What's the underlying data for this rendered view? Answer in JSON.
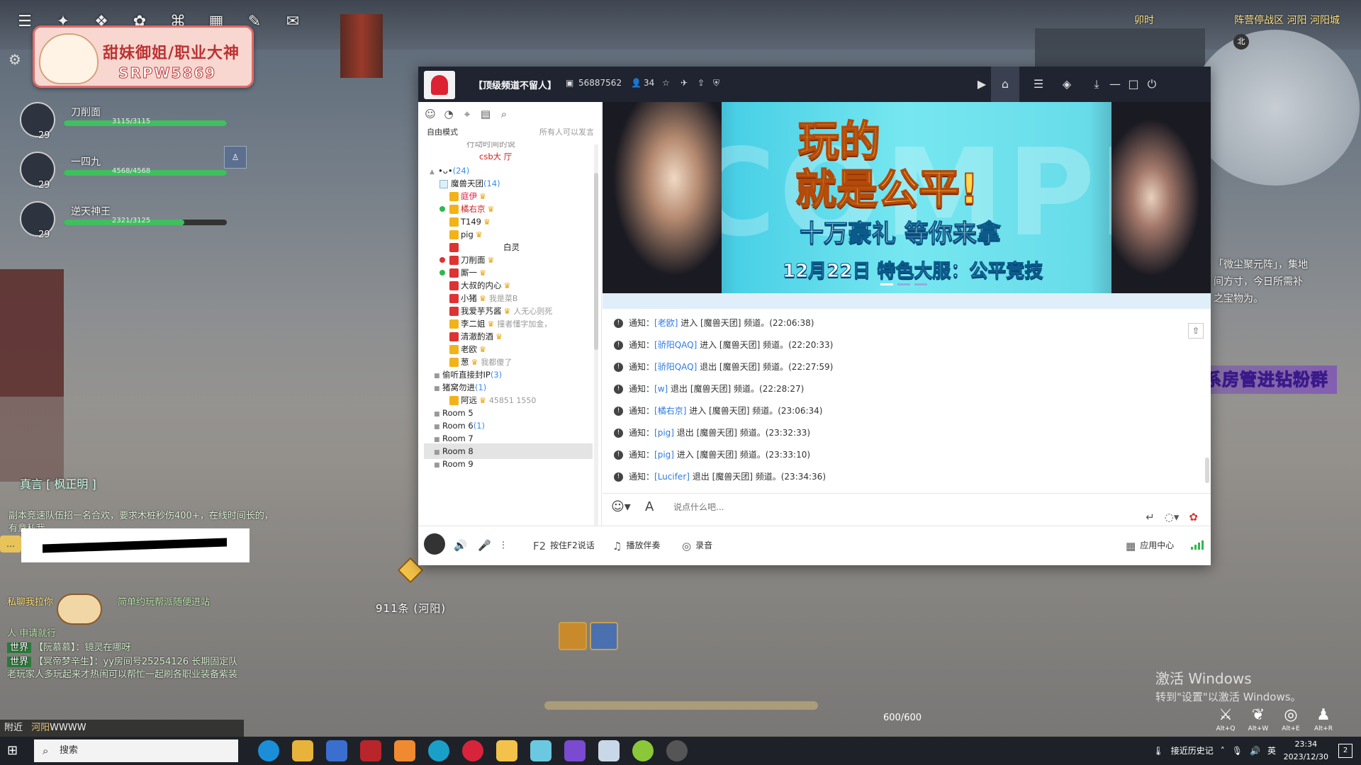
{
  "game": {
    "time": "卯时",
    "zone": "阵营停战区  河阳  河阳城",
    "sign": {
      "line1": "甜妹御姐/职业大神",
      "line2": "SRPW5869"
    },
    "party": [
      {
        "name": "刀削面",
        "hp": "3115/3115",
        "level": "29",
        "hp_fraction": 1.0
      },
      {
        "name": "一四九",
        "hp": "4568/4568",
        "level": "29",
        "hp_fraction": 1.0
      },
      {
        "name": "逆天神王",
        "hp": "2321/3125",
        "level": "29",
        "hp_fraction": 0.74
      }
    ],
    "speaker": "真言 [ 枫正明 ]",
    "chat": [
      "副本竞速队伍招一名合欢，要求木桩秒伤400+，在线时间长的，有意私我",
      "私聊我拉你",
      "简单约玩帮派随便进站",
      "人 申请就行"
    ],
    "world_chat": [
      {
        "tag": "世界",
        "text": "【阮慕慕】：镜灵在哪呀"
      },
      {
        "tag": "世界",
        "text": "【冥帝梦辛生】：yy房间号25254126 长期固定队老玩家人多玩起来才热闹可以帮忙一起刷各职业装备紫装"
      }
    ],
    "nearby": {
      "label": "附近",
      "location": "河阳",
      "text": "WWWW"
    },
    "npc_label": "911条 (河阳)",
    "side_text": [
      "「微尘聚元阵」，集地",
      "间方寸，今日所需补",
      "之宝物为。"
    ],
    "promo_banner": "钻粉开通联系房管进钻粉群",
    "energy": "600/600",
    "activate_windows": {
      "title": "激活 Windows",
      "sub": "转到\"设置\"以激活 Windows。"
    },
    "skills": [
      "Alt+Q",
      "Alt+W",
      "Alt+E",
      "Alt+R"
    ]
  },
  "yy": {
    "channel_name": "【顶级频道不留人】",
    "channel_id": "56887562",
    "online": "34",
    "mode": "自由模式",
    "permission": "所有人可以发言",
    "tree": [
      {
        "kind": "sub",
        "text": "行动时间的说"
      },
      {
        "kind": "sub",
        "text": "csb大 厅"
      },
      {
        "kind": "group",
        "text": "•ᴗ•",
        "count": "(24)"
      },
      {
        "kind": "channel",
        "text": "魔兽天团",
        "count": "(14)"
      },
      {
        "kind": "user",
        "text": "庭伊",
        "status": ""
      },
      {
        "kind": "user",
        "text": "橘右京",
        "status": "g"
      },
      {
        "kind": "user",
        "text": "T149",
        "status": ""
      },
      {
        "kind": "user",
        "text": "pig",
        "status": ""
      },
      {
        "kind": "user",
        "text": "白灵",
        "status": ""
      },
      {
        "kind": "user",
        "text": "刀削面",
        "status": "r"
      },
      {
        "kind": "user",
        "text": "厮一",
        "status": "g"
      },
      {
        "kind": "user",
        "text": "大叔的内心",
        "status": ""
      },
      {
        "kind": "user",
        "text": "小猪",
        "status": "",
        "sub": "我是菜B"
      },
      {
        "kind": "user",
        "text": "我爱芋艿酱",
        "status": "",
        "sub": "人无心则死"
      },
      {
        "kind": "user",
        "text": "李二姐",
        "status": "",
        "sub": "撞者懂字加金，"
      },
      {
        "kind": "user",
        "text": "清澈酌酒",
        "status": ""
      },
      {
        "kind": "user",
        "text": "老欧",
        "status": ""
      },
      {
        "kind": "user",
        "text": "葱",
        "status": "",
        "sub": "我都傻了"
      },
      {
        "kind": "channel",
        "text": "偷听直接封IP",
        "count": "(3)"
      },
      {
        "kind": "channel",
        "text": "猪窝勿进",
        "count": "(1)"
      },
      {
        "kind": "user",
        "text": "阿远",
        "status": "",
        "sub": "45851  1550"
      },
      {
        "kind": "room",
        "text": "Room 5",
        "count": ""
      },
      {
        "kind": "room",
        "text": "Room 6",
        "count": "(1)"
      },
      {
        "kind": "room",
        "text": "Room 7",
        "count": ""
      },
      {
        "kind": "room",
        "text": "Room 8",
        "count": ""
      },
      {
        "kind": "room",
        "text": "Room 9",
        "count": ""
      }
    ],
    "ad": {
      "watermark": "COMPETE",
      "line1": "玩的",
      "line2": "就是公平!",
      "line3": "十万豪礼  等你来拿",
      "line4": "12月22日  特色大服：公平竞技"
    },
    "messages": [
      {
        "prefix": "通知：",
        "user": "[老欧]",
        "text": " 进入 [魔兽天团] 频道。(22:06:38)"
      },
      {
        "prefix": "通知：",
        "user": "[骄阳QAQ]",
        "text": " 进入 [魔兽天团] 频道。(22:20:33)"
      },
      {
        "prefix": "通知：",
        "user": "[骄阳QAQ]",
        "text": " 退出 [魔兽天团] 频道。(22:27:59)"
      },
      {
        "prefix": "通知：",
        "user": "[w]",
        "text": " 退出 [魔兽天团] 频道。(22:28:27)"
      },
      {
        "prefix": "通知：",
        "user": "[橘右京]",
        "text": " 进入 [魔兽天团] 频道。(23:06:34)"
      },
      {
        "prefix": "通知：",
        "user": "[pig]",
        "text": " 退出 [魔兽天团] 频道。(23:32:33)"
      },
      {
        "prefix": "通知：",
        "user": "[pig]",
        "text": " 进入 [魔兽天团] 频道。(23:33:10)"
      },
      {
        "prefix": "通知：",
        "user": "[Lucifer]",
        "text": " 退出 [魔兽天团] 频道。(23:34:36)"
      }
    ],
    "input_placeholder": "说点什么吧...",
    "bottom": {
      "f2": "按住F2说话",
      "music": "播放伴奏",
      "record": "录音",
      "apps": "应用中心"
    }
  },
  "taskbar": {
    "search": "搜索",
    "tray_text": "接近历史记",
    "ime": "英",
    "time": "23:34",
    "date": "2023/12/30",
    "notif": "2"
  }
}
